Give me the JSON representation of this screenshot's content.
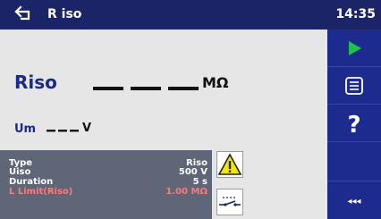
{
  "header": {
    "title": "R iso",
    "time": "14:35",
    "back_icon": "back-arrow-icon"
  },
  "measurement": {
    "main_label": "Riso",
    "main_value": "___",
    "main_unit": "MΩ",
    "sub_label": "Um",
    "sub_value": "___V"
  },
  "parameters": [
    {
      "name": "Type",
      "value": "Riso"
    },
    {
      "name": "Uiso",
      "value": "500 V"
    },
    {
      "name": "Duration",
      "value": "5 s"
    },
    {
      "name": "L Limit(Riso)",
      "value": "1.00 MΩ"
    }
  ],
  "indicators": {
    "warning_icon": "warning-triangle-icon",
    "switch_icon": "switch-contact-icon"
  },
  "sidebar": {
    "buttons": [
      {
        "name": "run",
        "icon": "play-icon"
      },
      {
        "name": "list",
        "icon": "list-icon"
      },
      {
        "name": "help",
        "icon": "help-icon",
        "label": "?"
      },
      {
        "name": "more",
        "icon": "more-arrows-icon",
        "label": "◂◂◂"
      }
    ]
  },
  "colors": {
    "header_bg": "#1b2466",
    "sidebar_bg": "#1d2a8e",
    "label_blue": "#1b2a8a",
    "limit_red": "#ff7a7a",
    "play_green": "#22c24a",
    "panel_grey": "#5e6677",
    "warning_yellow": "#f5e800"
  }
}
